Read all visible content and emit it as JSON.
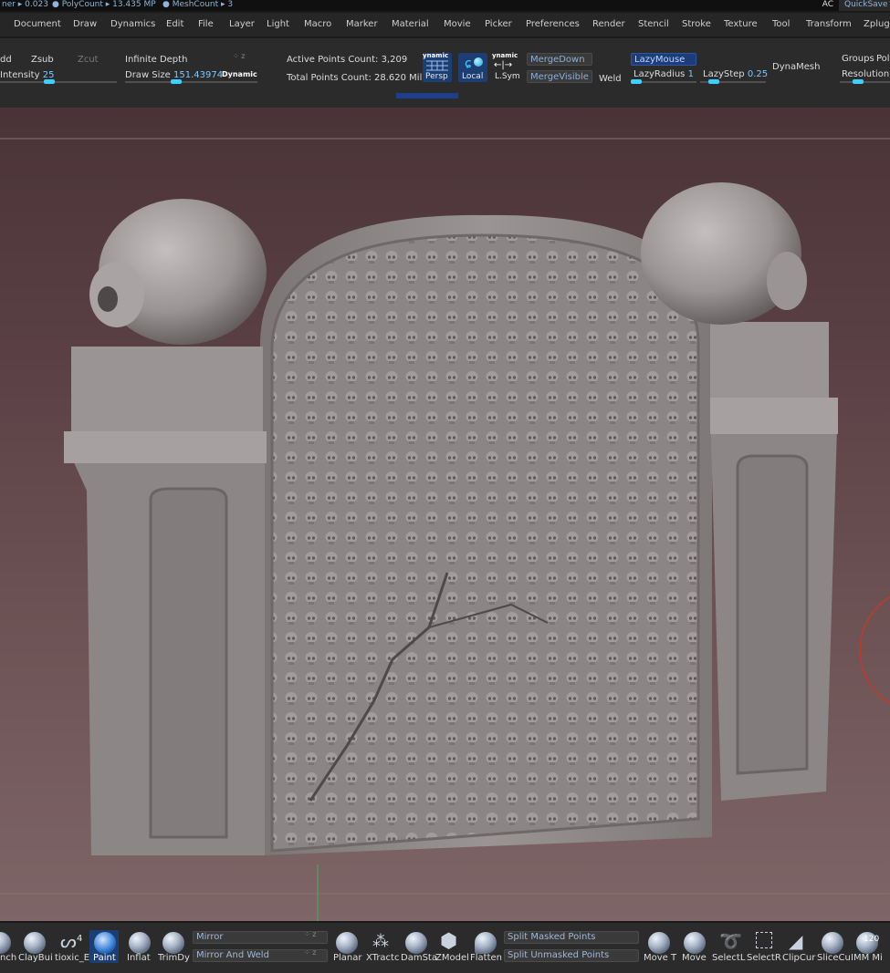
{
  "status": {
    "item1": "ner ▸ 0.023",
    "item2": "● PolyCount ▸ 13.435 MP",
    "item3": "● MeshCount ▸ 3",
    "ac": "AC",
    "quicksave": "QuickSave"
  },
  "menu": [
    "Document",
    "Draw",
    "Dynamics",
    "Edit",
    "File",
    "Layer",
    "Light",
    "Macro",
    "Marker",
    "Material",
    "Movie",
    "Picker",
    "Preferences",
    "Render",
    "Stencil",
    "Stroke",
    "Texture",
    "Tool",
    "Transform",
    "Zplugi"
  ],
  "toolbar": {
    "zadd": "dd",
    "zsub": "Zsub",
    "zcut": "Zcut",
    "intensity_label": "Intensity",
    "intensity_value": "25",
    "infinite_depth": "Infinite Depth",
    "draw_size_label": "Draw Size",
    "draw_size_value": "151.43974",
    "dynamic": "Dynamic",
    "active_points": "Active Points Count: 3,209",
    "total_points": "Total Points Count: 28.620 Mil",
    "persp_top": "ynamic",
    "persp": "Persp",
    "local": "Local",
    "lsym_top": "ynamic",
    "lsym": "L.Sym",
    "merge_down": "MergeDown",
    "merge_visible": "MergeVisible",
    "weld": "Weld",
    "lazy_mouse": "LazyMouse",
    "lazy_radius_label": "LazyRadius",
    "lazy_radius_value": "1",
    "lazy_step_label": "LazyStep",
    "lazy_step_value": "0.25",
    "dynamesh": "DynaMesh",
    "groups": "Groups",
    "polish": "Pol",
    "resolution": "Resolution"
  },
  "shelf": {
    "tools": [
      {
        "label": "nch"
      },
      {
        "label": "ClayBui"
      },
      {
        "label": "tioxic_E"
      },
      {
        "label": "Paint"
      },
      {
        "label": "Inflat"
      },
      {
        "label": "TrimDy"
      },
      {
        "label": "Planar"
      },
      {
        "label": "XTractc"
      },
      {
        "label": "DamSta"
      },
      {
        "label": "ZModel"
      },
      {
        "label": "Flatten"
      },
      {
        "label": "Move T"
      },
      {
        "label": "Move"
      },
      {
        "label": "SelectL"
      },
      {
        "label": "SelectR"
      },
      {
        "label": "ClipCur"
      },
      {
        "label": "SliceCu"
      },
      {
        "label": "IMM Mi"
      }
    ],
    "toxic_count": "4",
    "imm_count": "120",
    "mirror": "Mirror",
    "mirror_and_weld": "Mirror And Weld",
    "split_masked": "Split Masked Points",
    "split_unmasked": "Split Unmasked Points"
  },
  "colors": {
    "accent": "#3ad0ff",
    "selected": "#1c3e73",
    "value_text": "#7cc8ff"
  }
}
